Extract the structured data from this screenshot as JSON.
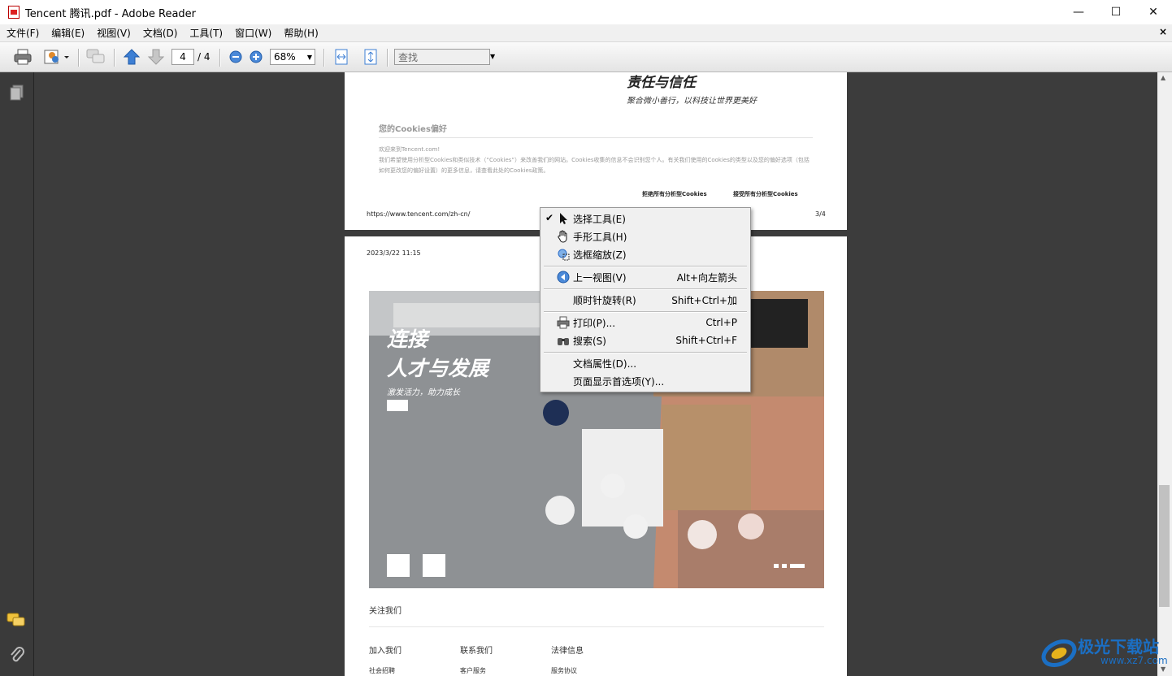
{
  "window": {
    "title": "Tencent 腾讯.pdf - Adobe Reader",
    "minimize": "—",
    "maximize": "☐",
    "close": "✕"
  },
  "menu": {
    "items": [
      "文件(F)",
      "编辑(E)",
      "视图(V)",
      "文档(D)",
      "工具(T)",
      "窗口(W)",
      "帮助(H)"
    ],
    "close_doc": "×"
  },
  "toolbar": {
    "page_current": "4",
    "page_total": "/ 4",
    "zoom": "68%",
    "search_placeholder": "查找"
  },
  "page3": {
    "heading": "责任与信任",
    "subheading": "聚合微小善行，以科技让世界更美好",
    "cookies_title": "您的Cookies偏好",
    "cookies_line1": "欢迎来到Tencent.com!",
    "cookies_line2": "我们希望使用分析型Cookies和类似技术（“Cookies”）来改善我们的网站。Cookies收集的信息不会识别您个人。有关我们使用的Cookies的类型以及您的偏好选项（包括",
    "cookies_line3": "如何更改您的偏好设置）的更多信息，请查看此处的Cookies政策。",
    "reject_cookies": "拒绝所有分析型Cookies",
    "accept_cookies": "接受所有分析型Cookies",
    "url": "https://www.tencent.com/zh-cn/",
    "page_number": "3/4"
  },
  "page4": {
    "timestamp": "2023/3/22 11:15",
    "hero_title1": "连接",
    "hero_title2": "人才与发展",
    "hero_subtitle": "激发活力，助力成长",
    "follow_us": "关注我们",
    "footer_cols": [
      "加入我们",
      "联系我们",
      "法律信息"
    ],
    "footer_links": [
      "社会招聘",
      "客户服务",
      "服务协议"
    ]
  },
  "context_menu": {
    "items": [
      {
        "label": "选择工具(E)",
        "shortcut": "",
        "checked": "✔"
      },
      {
        "label": "手形工具(H)",
        "shortcut": ""
      },
      {
        "label": "选框缩放(Z)",
        "shortcut": ""
      },
      {
        "label": "上一视图(V)",
        "shortcut": "Alt+向左箭头"
      },
      {
        "label": "顺时针旋转(R)",
        "shortcut": "Shift+Ctrl+加"
      },
      {
        "label": "打印(P)...",
        "shortcut": "Ctrl+P"
      },
      {
        "label": "搜索(S)",
        "shortcut": "Shift+Ctrl+F"
      },
      {
        "label": "文档属性(D)...",
        "shortcut": ""
      },
      {
        "label": "页面显示首选项(Y)...",
        "shortcut": ""
      }
    ]
  },
  "watermark": {
    "brand": "极光下载站",
    "url": "www.xz7.com"
  },
  "colors": {
    "toolbar_icon_blue": "#2e6fc9",
    "viewport_bg": "#3c3c3c",
    "watermark_blue": "#1b6fc4"
  }
}
